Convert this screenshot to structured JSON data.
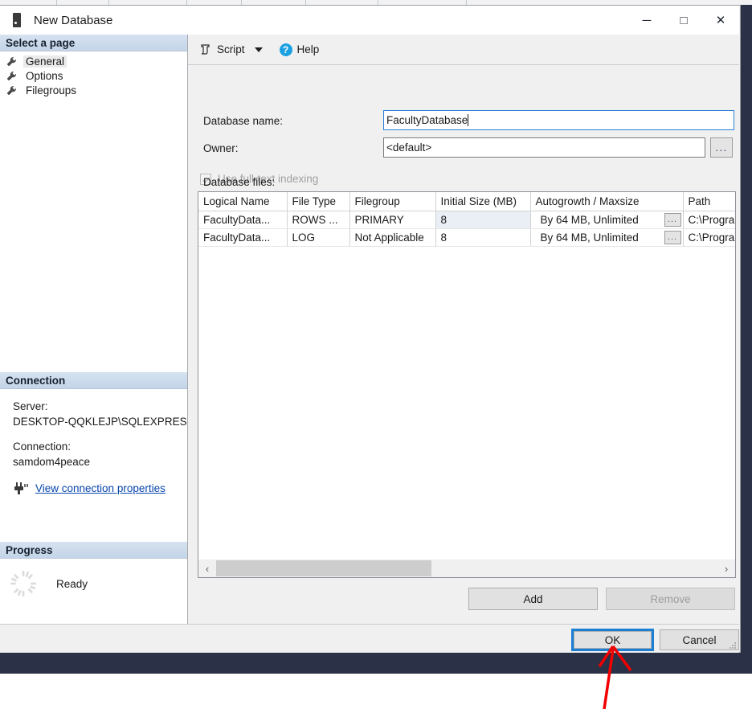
{
  "window": {
    "title": "New Database",
    "icon": "database-server-icon",
    "controls": {
      "minimize": "─",
      "maximize": "□",
      "close": "✕"
    }
  },
  "sidebar": {
    "header": "Select a page",
    "items": [
      {
        "label": "General",
        "icon": "wrench-icon",
        "selected": true
      },
      {
        "label": "Options",
        "icon": "wrench-icon",
        "selected": false
      },
      {
        "label": "Filegroups",
        "icon": "wrench-icon",
        "selected": false
      }
    ],
    "connection": {
      "header": "Connection",
      "server_label": "Server:",
      "server_value": "DESKTOP-QQKLEJP\\SQLEXPRESS",
      "connection_label": "Connection:",
      "connection_value": "samdom4peace",
      "link_label": "View connection properties",
      "link_icon": "plug-connection-icon",
      "link_color": "#0645ad"
    },
    "progress": {
      "header": "Progress",
      "status": "Ready",
      "icon": "spinner-ring-icon"
    }
  },
  "toolbar": {
    "script_label": "Script",
    "script_icon": "script-page-icon",
    "dropdown_icon": "chevron-down-icon",
    "help_label": "Help",
    "help_icon": "help-question-icon",
    "help_icon_color": "#1ba1e2"
  },
  "form": {
    "database_name_label": "Database name:",
    "database_name_value": "FacultyDatabase",
    "database_name_focused": true,
    "owner_label": "Owner:",
    "owner_value": "<default>",
    "owner_browse_label": "...",
    "fulltext_label": "Use full-text indexing",
    "fulltext_checked": true,
    "fulltext_disabled": true,
    "files_label": "Database files:"
  },
  "grid": {
    "columns": [
      "Logical Name",
      "File Type",
      "Filegroup",
      "Initial Size (MB)",
      "Autogrowth / Maxsize",
      "Path"
    ],
    "rows": [
      {
        "logical_name": "FacultyData...",
        "file_type": "ROWS ...",
        "filegroup": "PRIMARY",
        "initial_size": "8",
        "autogrowth": "By 64 MB, Unlimited",
        "autogrowth_button": "...",
        "path": "C:\\Progra",
        "selected_cell": "initial_size"
      },
      {
        "logical_name": "FacultyData...",
        "file_type": "LOG",
        "filegroup": "Not Applicable",
        "initial_size": "8",
        "autogrowth": "By 64 MB, Unlimited",
        "autogrowth_button": "...",
        "path": "C:\\Progra",
        "selected_cell": ""
      }
    ],
    "scrollbar": {
      "left_arrow": "‹",
      "right_arrow": "›",
      "thumb_percent": 43
    }
  },
  "buttons": {
    "add": "Add",
    "remove": "Remove",
    "remove_disabled": true,
    "ok": "OK",
    "ok_highlight_color": "#1b7fd4",
    "cancel": "Cancel"
  },
  "annotation": {
    "arrow_color": "#f20000",
    "points_to": "ok-button"
  }
}
